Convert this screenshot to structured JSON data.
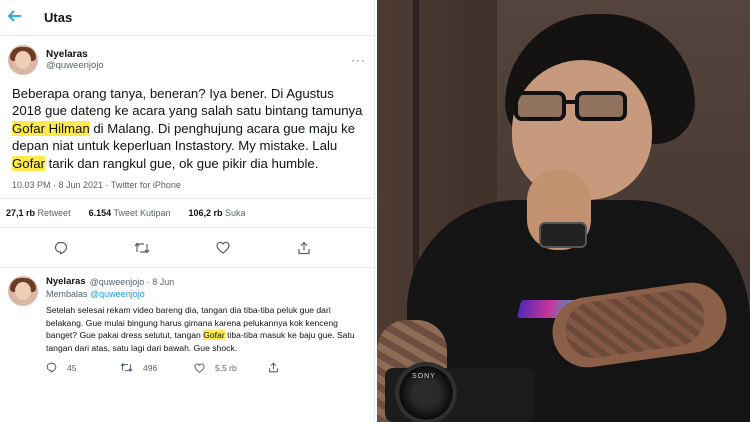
{
  "header": {
    "title": "Utas"
  },
  "tweet": {
    "author_name": "Nyelaras",
    "author_handle": "@quweenjojo",
    "text_parts": {
      "p1": "Beberapa orang tanya, beneran? Iya bener. Di Agustus 2018 gue dateng ke acara yang salah satu bintang tamunya ",
      "h1": "Gofar Hilman",
      "p2": " di Malang. Di penghujung acara gue maju ke depan niat untuk keperluan Instastory. My mistake. Lalu ",
      "h2": "Gofar",
      "p3": " tarik dan rangkul gue, ok gue pikir dia humble."
    },
    "meta": "10.03 PM · 8 Jun 2021 · Twitter for iPhone",
    "stats": {
      "retweet_count": "27,1 rb",
      "retweet_label": "Retweet",
      "quote_count": "6.154",
      "quote_label": "Tweet Kutipan",
      "like_count": "106,2 rb",
      "like_label": "Suka"
    }
  },
  "reply": {
    "author_name": "Nyelaras",
    "author_handle": "@quweenjojo · 8 Jun",
    "replying_to_label": "Membalas",
    "replying_to_handle": "@quweenjojo",
    "text_parts": {
      "p1": "Setelah selesai rekam video bareng dia, tangan dia tiba-tiba peluk gue dari belakang. Gue mulai bingung harus gimana karena pelukannya kok kenceng banget? Gue pakai dress selutut, tangan ",
      "h1": "Gofar",
      "p2": " tiba-tiba masuk ke baju gue. Satu tangan dari atas, satu lagi dari bawah. Gue shock."
    },
    "reply_count": "45",
    "retweet_count": "496",
    "like_count": "5,5 rb"
  },
  "photo": {
    "camera_brand": "SONY"
  },
  "colors": {
    "accent": "#1d9bf0",
    "highlight": "#ffe94d",
    "muted": "#536471"
  }
}
